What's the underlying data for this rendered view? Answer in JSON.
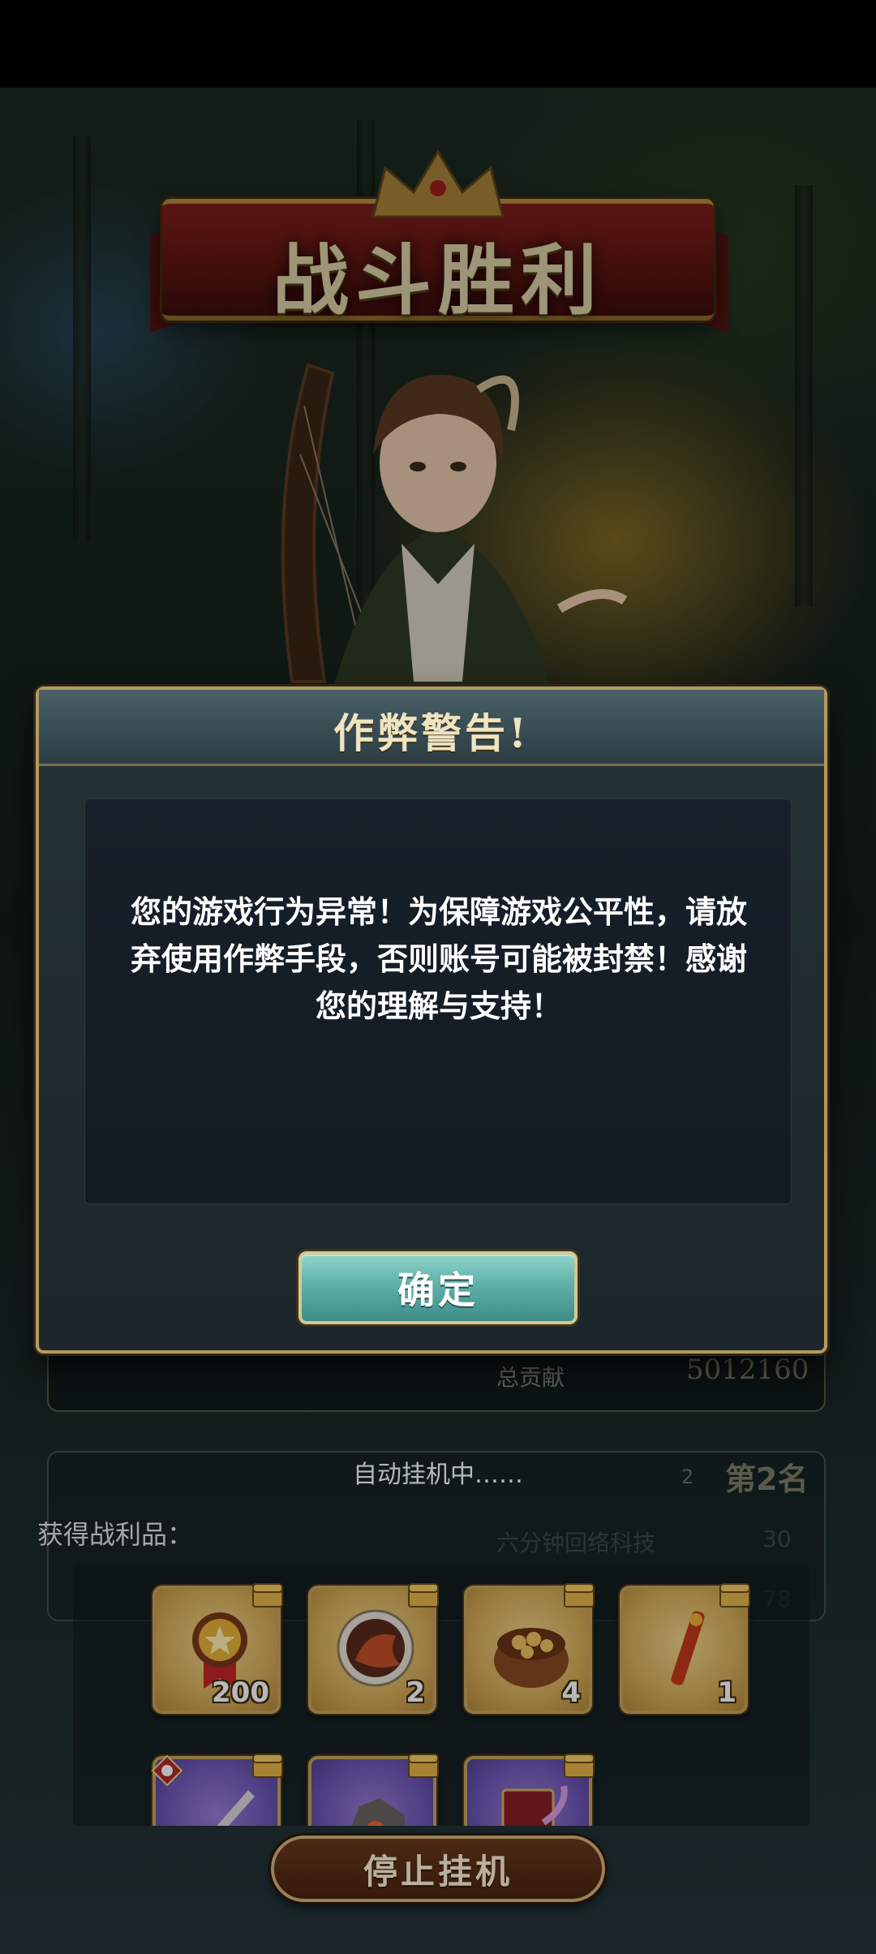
{
  "banner": {
    "title": "战斗胜利"
  },
  "result": {
    "contribution_label": "总贡献",
    "contribution_value": "5012160"
  },
  "dialog": {
    "title": "作弊警告!",
    "message_lines": [
      "您的游戏行为异常！为保障游戏公平性，请放",
      "弃使用作弊手段，否则账号可能被封禁！感谢",
      "您的理解与支持！"
    ],
    "confirm_label": "确定"
  },
  "auto_battle": {
    "status": "自动挂机中……",
    "rank_number": "2",
    "rank_text": "第2名",
    "faded_row_label": "六分钟回络科技",
    "faded_row_value": "30",
    "faded_row_value2": "78"
  },
  "loot": {
    "label": "获得战利品：",
    "items": [
      {
        "icon": "medal-icon",
        "count": "200"
      },
      {
        "icon": "dragon-orb-icon",
        "count": "2"
      },
      {
        "icon": "food-pot-icon",
        "count": "4"
      },
      {
        "icon": "flute-icon",
        "count": "1"
      },
      {
        "icon": "sword-icon",
        "count": ""
      },
      {
        "icon": "ore-icon",
        "count": ""
      },
      {
        "icon": "book-icon",
        "count": ""
      }
    ]
  },
  "stop_button": {
    "label": "停止挂机"
  },
  "colors": {
    "accent_gold": "#b49a5e",
    "confirm_teal": "#5fb0a8",
    "banner_red": "#7e1e1a"
  }
}
